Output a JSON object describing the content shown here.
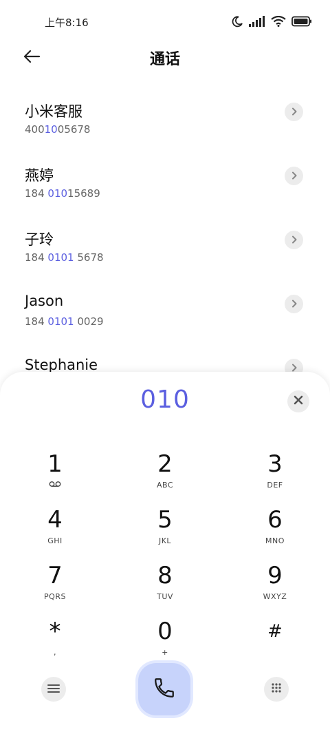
{
  "status_bar": {
    "time": "上午8:16",
    "icons": [
      "moon-icon",
      "signal-icon",
      "wifi-icon",
      "battery-icon"
    ]
  },
  "header": {
    "title": "通话",
    "back_icon": "back-arrow-icon"
  },
  "results": [
    {
      "name": "小米客服",
      "number_parts": {
        "before": "400",
        "match": "10",
        "after": "05678"
      }
    },
    {
      "name": "燕婷",
      "number_parts": {
        "before": "184 ",
        "match": "010",
        "after": "15689"
      }
    },
    {
      "name": "子玲",
      "number_parts": {
        "before": "184 ",
        "match": "0101",
        "after": " 5678"
      }
    },
    {
      "name": "Jason",
      "number_parts": {
        "before": "184 ",
        "match": "0101",
        "after": " 0029"
      }
    },
    {
      "name": "Stephanie",
      "number_parts": {
        "before": "",
        "match": "",
        "after": ""
      }
    }
  ],
  "dialer": {
    "input": "010",
    "keys": [
      {
        "digit": "1",
        "sub": "",
        "sub_icon": "voicemail-icon"
      },
      {
        "digit": "2",
        "sub": "ABC"
      },
      {
        "digit": "3",
        "sub": "DEF"
      },
      {
        "digit": "4",
        "sub": "GHI"
      },
      {
        "digit": "5",
        "sub": "JKL"
      },
      {
        "digit": "6",
        "sub": "MNO"
      },
      {
        "digit": "7",
        "sub": "PQRS"
      },
      {
        "digit": "8",
        "sub": "TUV"
      },
      {
        "digit": "9",
        "sub": "WXYZ"
      },
      {
        "digit": "*",
        "sub": ","
      },
      {
        "digit": "0",
        "sub": "+"
      },
      {
        "digit": "#",
        "sub": ""
      }
    ]
  },
  "colors": {
    "accent": "#5b5fe0",
    "call_button": "#c7d3fb",
    "chip_bg": "#ececec"
  }
}
